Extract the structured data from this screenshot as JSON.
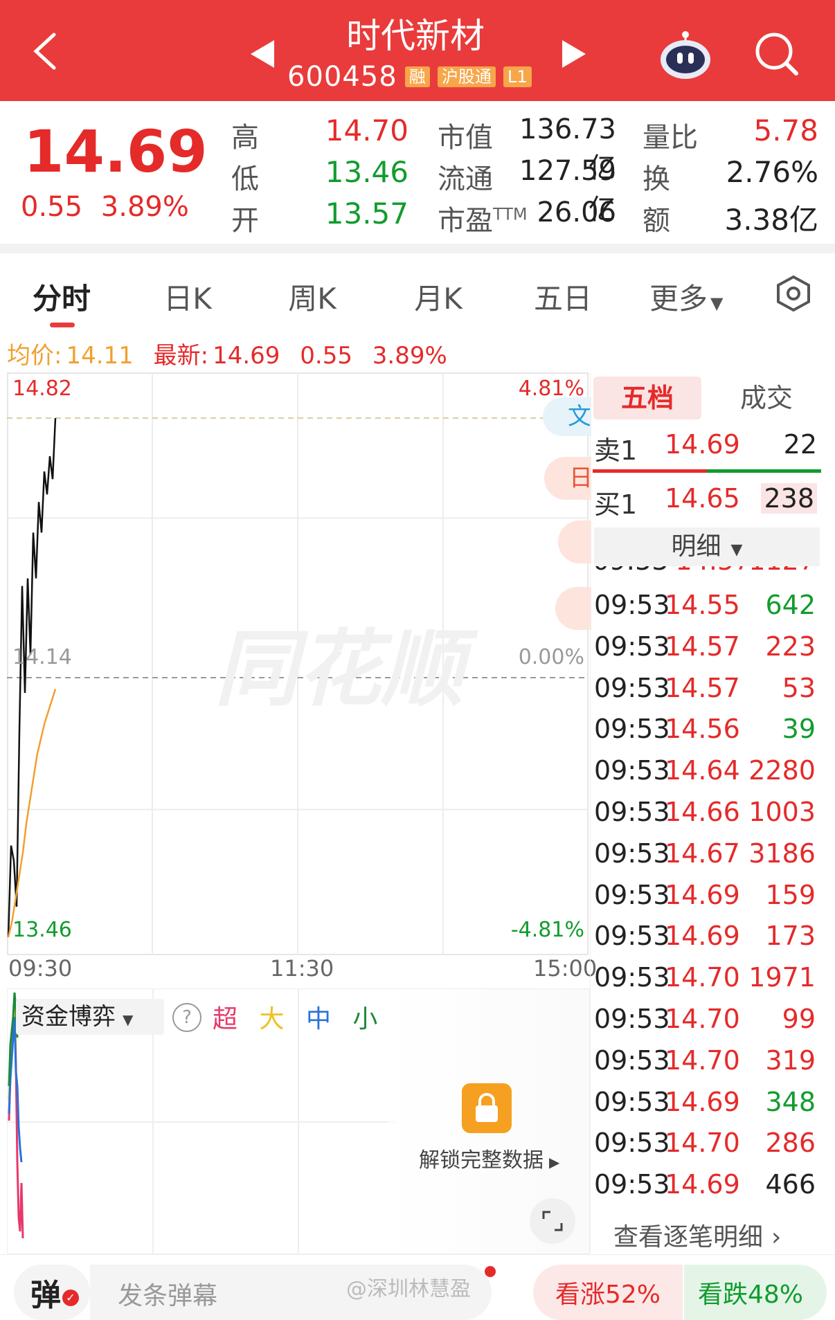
{
  "header": {
    "title": "时代新材",
    "code": "600458",
    "tags": [
      "融",
      "沪股通",
      "L1"
    ]
  },
  "quote": {
    "price": "14.69",
    "change": "0.55",
    "change_pct": "3.89%",
    "high_label": "高",
    "high": "14.70",
    "low_label": "低",
    "low": "13.46",
    "open_label": "开",
    "open": "13.57",
    "mktcap_label": "市值",
    "mktcap": "136.73亿",
    "float_label": "流通",
    "float": "127.59亿",
    "pe_label": "市盈",
    "pe_sup": "TTM",
    "pe": "26.06",
    "vr_label": "量比",
    "vr": "5.78",
    "turn_label": "换",
    "turn": "2.76%",
    "amt_label": "额",
    "amt": "3.38亿"
  },
  "tabs": [
    "分时",
    "日K",
    "周K",
    "月K",
    "五日",
    "更多"
  ],
  "active_tab": "分时",
  "info_line": {
    "avg_label": "均价:",
    "avg": "14.11",
    "latest_label": "最新:",
    "latest": "14.69",
    "change": "0.55",
    "change_pct": "3.89%"
  },
  "chart_data": {
    "type": "line",
    "title": "",
    "x_ticks": [
      "09:30",
      "11:30",
      "15:00"
    ],
    "y_ticks_left": [
      "14.82",
      "14.14",
      "13.46"
    ],
    "y_ticks_right": [
      "4.81%",
      "0.00%",
      "-4.81%"
    ],
    "ylim": [
      13.46,
      14.82
    ],
    "reference": 14.14,
    "series": [
      {
        "role": "price",
        "color": "#111111",
        "values": [
          13.46,
          13.7,
          13.66,
          13.54,
          14.0,
          14.38,
          14.1,
          14.4,
          14.2,
          14.52,
          14.4,
          14.6,
          14.52,
          14.68,
          14.62,
          14.72,
          14.66,
          14.82
        ]
      },
      {
        "role": "average",
        "color": "#f0a030",
        "values": [
          13.46,
          13.5,
          13.56,
          13.62,
          13.68,
          13.76,
          13.82,
          13.88,
          13.94,
          13.98,
          14.02,
          14.05,
          14.08,
          14.11
        ]
      }
    ],
    "watermark": "同花顺"
  },
  "side_tabs": [
    "文",
    "日",
    "",
    "",
    ""
  ],
  "orderbook": {
    "tabs": [
      "五档",
      "成交"
    ],
    "sell": {
      "label": "卖1",
      "price": "14.69",
      "vol": "22"
    },
    "buy": {
      "label": "买1",
      "price": "14.65",
      "vol": "238"
    },
    "detail_label": "明细"
  },
  "trades": [
    {
      "time": "09:53",
      "price": "14.55",
      "vol": "642",
      "dir": "green"
    },
    {
      "time": "09:53",
      "price": "14.57",
      "vol": "223",
      "dir": "red"
    },
    {
      "time": "09:53",
      "price": "14.57",
      "vol": "53",
      "dir": "red"
    },
    {
      "time": "09:53",
      "price": "14.56",
      "vol": "39",
      "dir": "green"
    },
    {
      "time": "09:53",
      "price": "14.64",
      "vol": "2280",
      "dir": "red"
    },
    {
      "time": "09:53",
      "price": "14.66",
      "vol": "1003",
      "dir": "red"
    },
    {
      "time": "09:53",
      "price": "14.67",
      "vol": "3186",
      "dir": "red"
    },
    {
      "time": "09:53",
      "price": "14.69",
      "vol": "159",
      "dir": "red"
    },
    {
      "time": "09:53",
      "price": "14.69",
      "vol": "173",
      "dir": "red"
    },
    {
      "time": "09:53",
      "price": "14.70",
      "vol": "1971",
      "dir": "red"
    },
    {
      "time": "09:53",
      "price": "14.70",
      "vol": "99",
      "dir": "red"
    },
    {
      "time": "09:53",
      "price": "14.70",
      "vol": "319",
      "dir": "red"
    },
    {
      "time": "09:53",
      "price": "14.69",
      "vol": "348",
      "dir": "green"
    },
    {
      "time": "09:53",
      "price": "14.70",
      "vol": "286",
      "dir": "red"
    },
    {
      "time": "09:53",
      "price": "14.69",
      "vol": "466",
      "dir": "dark"
    }
  ],
  "trades_more": "查看逐笔明细",
  "capital": {
    "selector": "资金博弈",
    "sizes": [
      "超",
      "大",
      "中",
      "小"
    ],
    "size_colors": [
      "#e8386a",
      "#f0c020",
      "#2a72d8",
      "#1a8a3a"
    ],
    "unlock": "解锁完整数据"
  },
  "bottom": {
    "danmu_icon": "弹",
    "danmu_placeholder": "发条弹幕",
    "watermark": "@深圳林慧盈",
    "up": "看涨52%",
    "down": "看跌48%"
  },
  "colors": {
    "brand": "#e93b3b",
    "up": "#e52a2a",
    "down": "#119c2e",
    "avg": "#f0a030"
  }
}
